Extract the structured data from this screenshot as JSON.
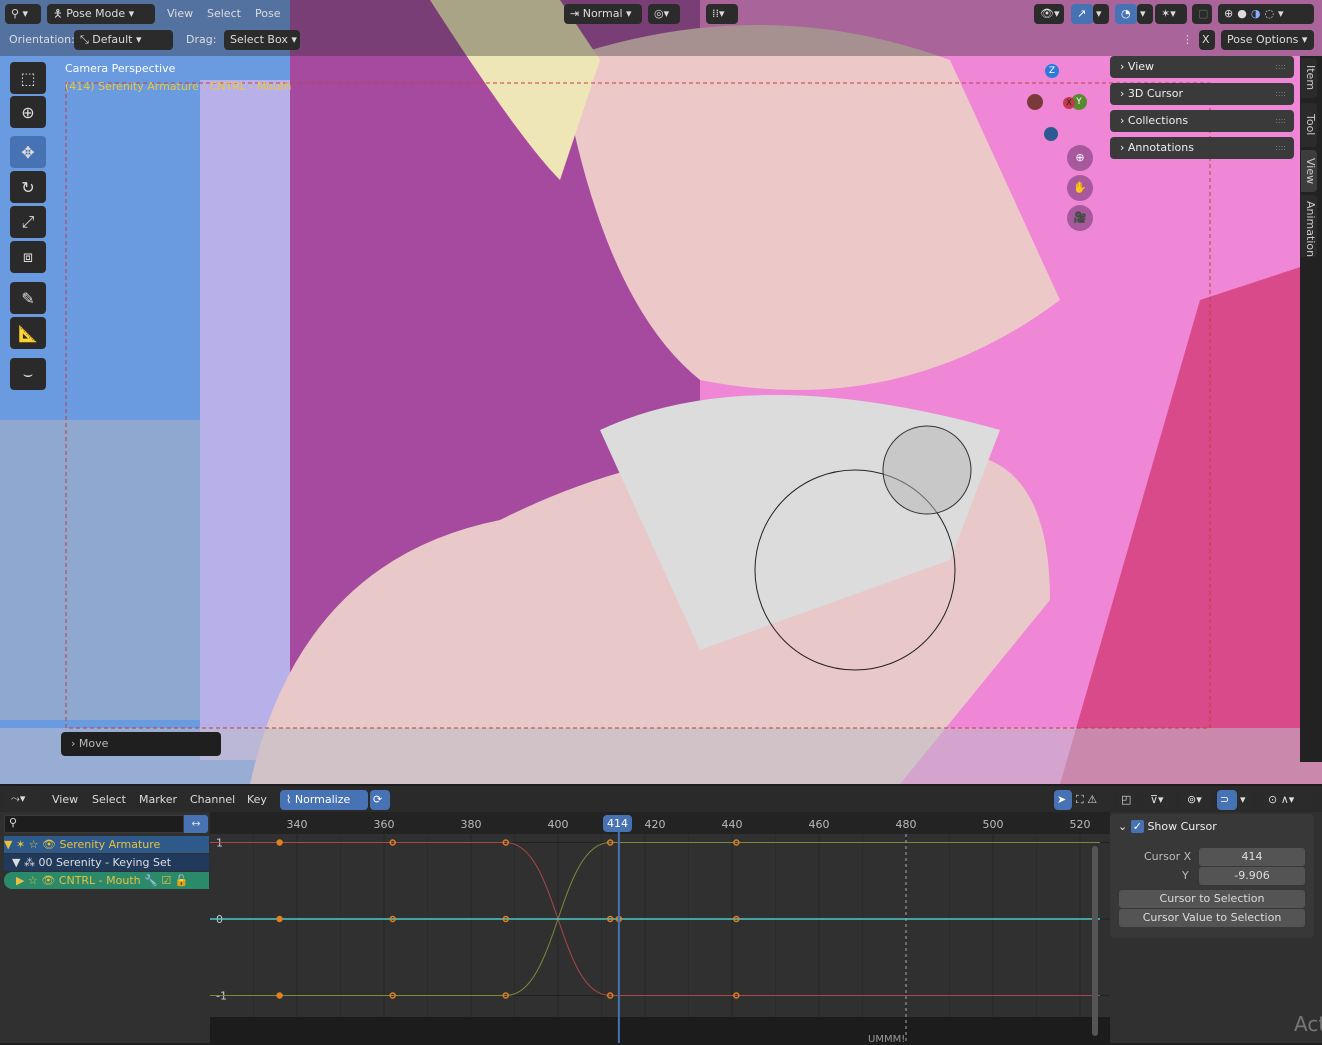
{
  "header": {
    "editor_icon": "armature-pose-icon",
    "mode": "Pose Mode",
    "menus": [
      "View",
      "Select",
      "Pose"
    ],
    "transform_orientation": "Normal",
    "orientation_label": "Orientation:",
    "orientation_value": "Default",
    "drag_label": "Drag:",
    "drag_value": "Select Box",
    "pose_options": "Pose Options",
    "x_mirror": "X"
  },
  "viewport": {
    "title": "Camera Perspective",
    "subtitle": "(414) Serenity Armature : CNTRL - Mouth",
    "last_op": "Move",
    "gizmo_axes": [
      "Z",
      "Y",
      "X"
    ],
    "tools": [
      "select-box-icon",
      "cursor-icon",
      "move-icon",
      "rotate-icon",
      "scale-icon",
      "transform-icon",
      "annotate-icon",
      "measure-icon",
      "bone-envelope-icon"
    ],
    "npanel": [
      "View",
      "3D Cursor",
      "Collections",
      "Annotations"
    ],
    "tabs": [
      "Item",
      "Tool",
      "View",
      "Animation"
    ]
  },
  "graph_editor": {
    "menus": [
      "View",
      "Select",
      "Marker",
      "Channel",
      "Key"
    ],
    "normalize": "Normalize",
    "channels": [
      {
        "name": "Serenity Armature"
      },
      {
        "name": "00 Serenity - Keying Set"
      },
      {
        "name": "CNTRL - Mouth"
      }
    ],
    "current_frame": "414",
    "frame_ticks": [
      "340",
      "360",
      "380",
      "400",
      "420",
      "440",
      "460",
      "480",
      "500",
      "520"
    ],
    "value_ticks": [
      "1",
      "0",
      "-1"
    ],
    "marker": "UMMM!",
    "sidebar": {
      "show_cursor": "Show Cursor",
      "cursor_x_label": "Cursor X",
      "cursor_x": "414",
      "cursor_y_label": "Y",
      "cursor_y": "-9.906",
      "cursor_to_selection": "Cursor to Selection",
      "cursor_value_to_selection": "Cursor Value to Selection"
    },
    "curves": [
      {
        "color": "#a84848",
        "keys": [
          [
            336,
            1
          ],
          [
            362,
            1
          ],
          [
            388,
            1
          ],
          [
            412,
            -1
          ],
          [
            441,
            -1
          ]
        ]
      },
      {
        "color": "#7a8a3a",
        "keys": [
          [
            336,
            -1
          ],
          [
            362,
            -1
          ],
          [
            388,
            -1
          ],
          [
            412,
            1
          ],
          [
            441,
            1
          ]
        ]
      },
      {
        "color": "#4cc8c8",
        "keys": [
          [
            336,
            0
          ],
          [
            362,
            0
          ],
          [
            388,
            0
          ],
          [
            412,
            0
          ],
          [
            414,
            0
          ],
          [
            441,
            0
          ]
        ]
      }
    ],
    "watermark": "Act"
  }
}
